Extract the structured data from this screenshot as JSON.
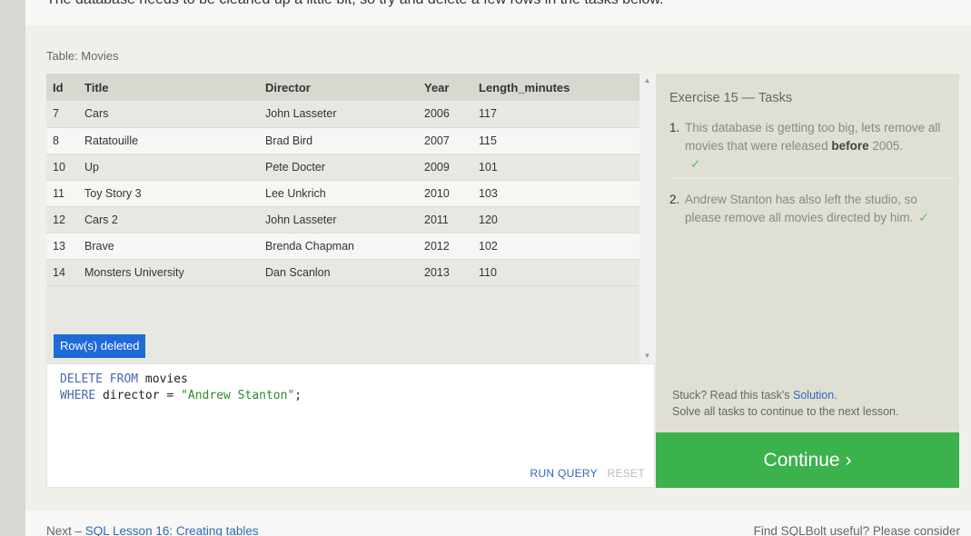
{
  "intro": {
    "text": "The database needs to be cleaned up a little bit, so try and delete a few rows in the tasks below."
  },
  "table": {
    "caption": "Table: Movies",
    "columns": [
      "Id",
      "Title",
      "Director",
      "Year",
      "Length_minutes"
    ],
    "rows": [
      [
        "7",
        "Cars",
        "John Lasseter",
        "2006",
        "117"
      ],
      [
        "8",
        "Ratatouille",
        "Brad Bird",
        "2007",
        "115"
      ],
      [
        "10",
        "Up",
        "Pete Docter",
        "2009",
        "101"
      ],
      [
        "11",
        "Toy Story 3",
        "Lee Unkrich",
        "2010",
        "103"
      ],
      [
        "12",
        "Cars 2",
        "John Lasseter",
        "2011",
        "120"
      ],
      [
        "13",
        "Brave",
        "Brenda Chapman",
        "2012",
        "102"
      ],
      [
        "14",
        "Monsters University",
        "Dan Scanlon",
        "2013",
        "110"
      ]
    ],
    "status_badge": "Row(s) deleted"
  },
  "editor": {
    "line1_kw": "DELETE FROM",
    "line1_rest": " movies",
    "line2_kw": "WHERE",
    "line2_mid": " director = ",
    "line2_str": "\"Andrew Stanton\"",
    "line2_end": ";",
    "run_label": "RUN QUERY",
    "reset_label": "RESET"
  },
  "tasks": {
    "title": "Exercise 15 — Tasks",
    "items": [
      {
        "num": "1.",
        "text_before": "This database is getting too big, lets remove all movies that were released ",
        "bold": "before",
        "text_after": " 2005.",
        "check": "✓"
      },
      {
        "num": "2.",
        "text": "Andrew Stanton has also left the studio, so please remove all movies directed by him.",
        "check": "✓"
      }
    ],
    "stuck_prefix": "Stuck? Read this task's ",
    "solution_label": "Solution",
    "stuck_suffix": ".",
    "solve_all": "Solve all tasks to continue to the next lesson.",
    "continue_label": "Continue ›"
  },
  "footer": {
    "next_prefix": "Next – ",
    "next_link": "SQL Lesson 16: Creating tables",
    "find_text": "Find SQLBolt useful? Please consider"
  },
  "colors": {
    "accent_blue": "#1e6ad9",
    "continue_green": "#3bb24c",
    "check_green": "#5bb85b"
  },
  "icons": {
    "scroll_up": "triangle-up",
    "scroll_down": "triangle-down"
  }
}
